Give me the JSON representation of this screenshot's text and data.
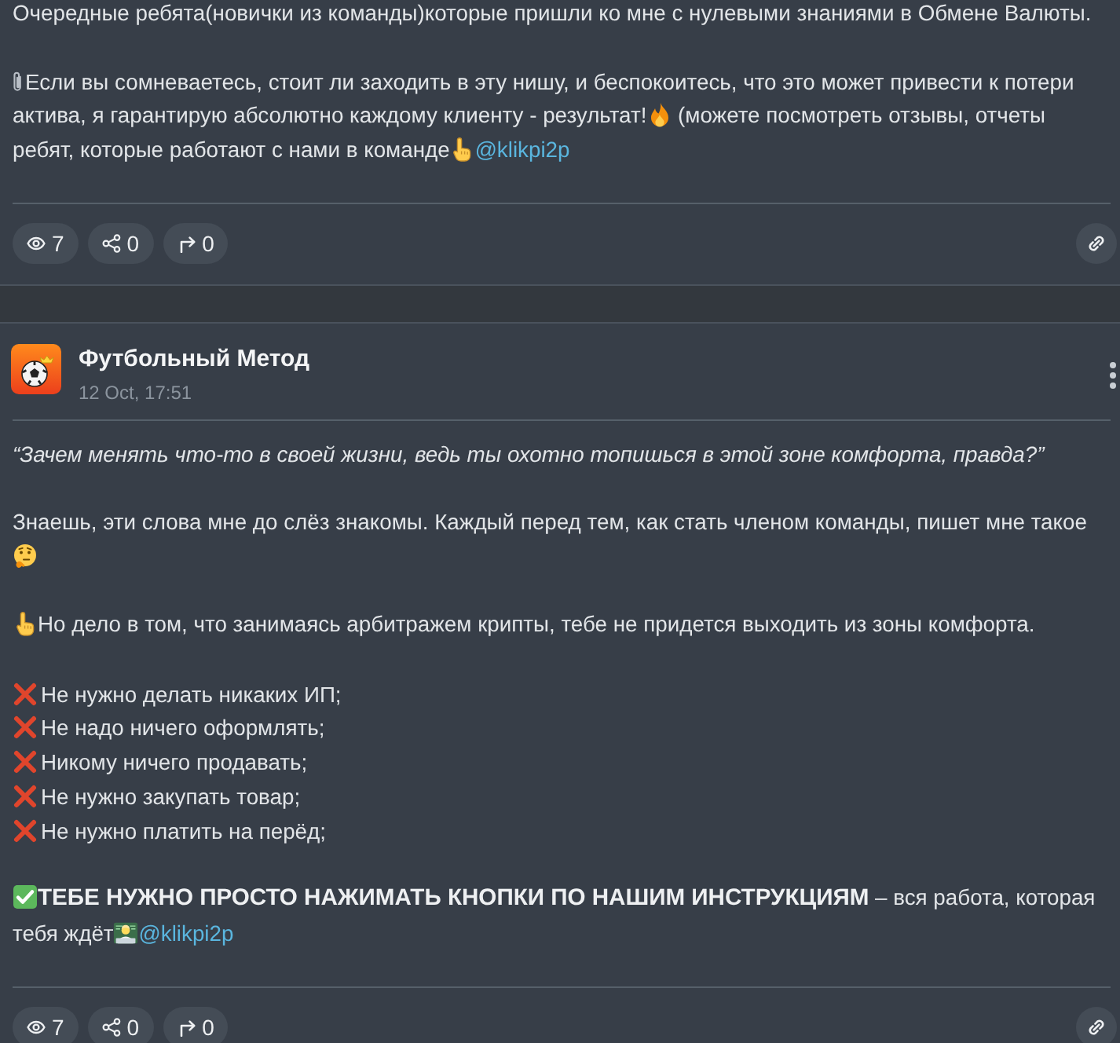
{
  "posts": [
    {
      "body": [
        {
          "kind": "paragraph",
          "segments": [
            {
              "kind": "text",
              "text": "Очередные ребята(новички из команды)которые пришли ко мне с нулевыми знаниями в Обмене Валюты."
            }
          ]
        },
        {
          "kind": "paragraph",
          "segments": [
            {
              "kind": "paperclip"
            },
            {
              "kind": "text",
              "text": "Если вы сомневаетесь, стоит ли заходить в эту нишу, и беспокоитесь, что это может привести к потери актива, я гарантирую абсолютно каждому клиенту - результат!"
            },
            {
              "kind": "fire"
            },
            {
              "kind": "text",
              "text": " (можете посмотреть отзывы, отчеты ребят, которые работают с нами в команде"
            },
            {
              "kind": "pointing-hand"
            },
            {
              "kind": "mention",
              "text": "@klikpi2p"
            }
          ]
        }
      ],
      "footer": {
        "stats": [
          {
            "kind": "views",
            "count": "7"
          },
          {
            "kind": "shares",
            "count": "0"
          },
          {
            "kind": "forwards",
            "count": "0"
          }
        ]
      }
    },
    {
      "channel": {
        "name": "Футбольный Метод",
        "date": "12 Oct, 17:51"
      },
      "body": [
        {
          "kind": "quote",
          "segments": [
            {
              "kind": "text",
              "text": "“Зачем менять что-то в своей жизни, ведь ты охотно топишься в этой зоне комфорта, правда?”"
            }
          ]
        },
        {
          "kind": "paragraph",
          "segments": [
            {
              "kind": "text",
              "text": "Знаешь, эти слова мне до слёз знакомы. Каждый перед тем, как стать членом команды, пишет мне такое "
            },
            {
              "kind": "thinking-face"
            }
          ]
        },
        {
          "kind": "paragraph",
          "segments": [
            {
              "kind": "pointing-hand"
            },
            {
              "kind": "text",
              "text": "Но дело в том, что занимаясь арбитражем крипты, тебе не придется выходить из зоны комфорта."
            }
          ]
        },
        {
          "kind": "cross-list",
          "items": [
            {
              "text": "Не нужно делать никаких ИП;"
            },
            {
              "text": "Не надо ничего оформлять;"
            },
            {
              "text": "Никому ничего продавать;"
            },
            {
              "text": "Не нужно закупать товар;"
            },
            {
              "text": "Не нужно платить на перёд;"
            }
          ]
        },
        {
          "kind": "paragraph",
          "segments": [
            {
              "kind": "check"
            },
            {
              "kind": "text",
              "text": "**ТЕБЕ НУЖНО ПРОСТО НАЖИМАТЬ КНОПКИ ПО НАШИМ ИНСТРУКЦИЯМ** – вся работа, которая тебя ждёт"
            },
            {
              "kind": "technologist"
            },
            {
              "kind": "mention",
              "text": "@klikpi2p"
            }
          ]
        }
      ],
      "footer": {
        "stats": [
          {
            "kind": "views",
            "count": "7"
          },
          {
            "kind": "shares",
            "count": "0"
          },
          {
            "kind": "forwards",
            "count": "0"
          }
        ]
      }
    }
  ]
}
